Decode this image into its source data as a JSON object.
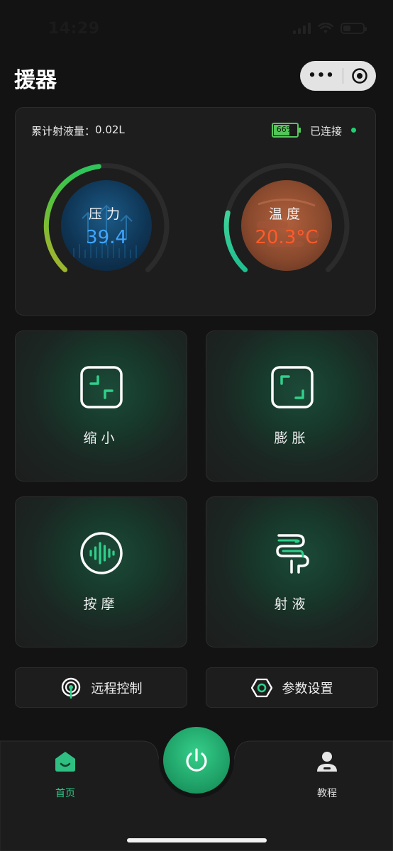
{
  "status_bar": {
    "time": "14:29"
  },
  "header": {
    "title": "援器"
  },
  "status_card": {
    "volume_label": "累计射液量：",
    "volume_value": "0.02L",
    "battery_percent": "66%",
    "battery_level": 0.66,
    "connection_status": "已连接",
    "connection_color": "#20d070",
    "gauges": [
      {
        "label": "压力",
        "value": "39.4",
        "color": "#3fa5ff",
        "icon": "pressure-arrows-icon"
      },
      {
        "label": "温度",
        "value": "20.3°C",
        "color": "#ff5a2a",
        "icon": "temperature-icon"
      }
    ]
  },
  "features": [
    {
      "label": "缩小",
      "icon": "shrink-icon"
    },
    {
      "label": "膨胀",
      "icon": "expand-icon"
    },
    {
      "label": "按摩",
      "icon": "massage-wave-icon"
    },
    {
      "label": "射液",
      "icon": "spray-icon"
    }
  ],
  "buttons": [
    {
      "label": "远程控制",
      "icon": "remote-signal-icon"
    },
    {
      "label": "参数设置",
      "icon": "hex-settings-icon"
    }
  ],
  "tab_bar": {
    "items": [
      {
        "label": "首页",
        "icon": "home-icon",
        "active": true
      },
      {
        "label": "教程",
        "icon": "user-icon",
        "active": false
      }
    ],
    "center": {
      "icon": "power-icon"
    },
    "accent_color": "#31c489"
  }
}
